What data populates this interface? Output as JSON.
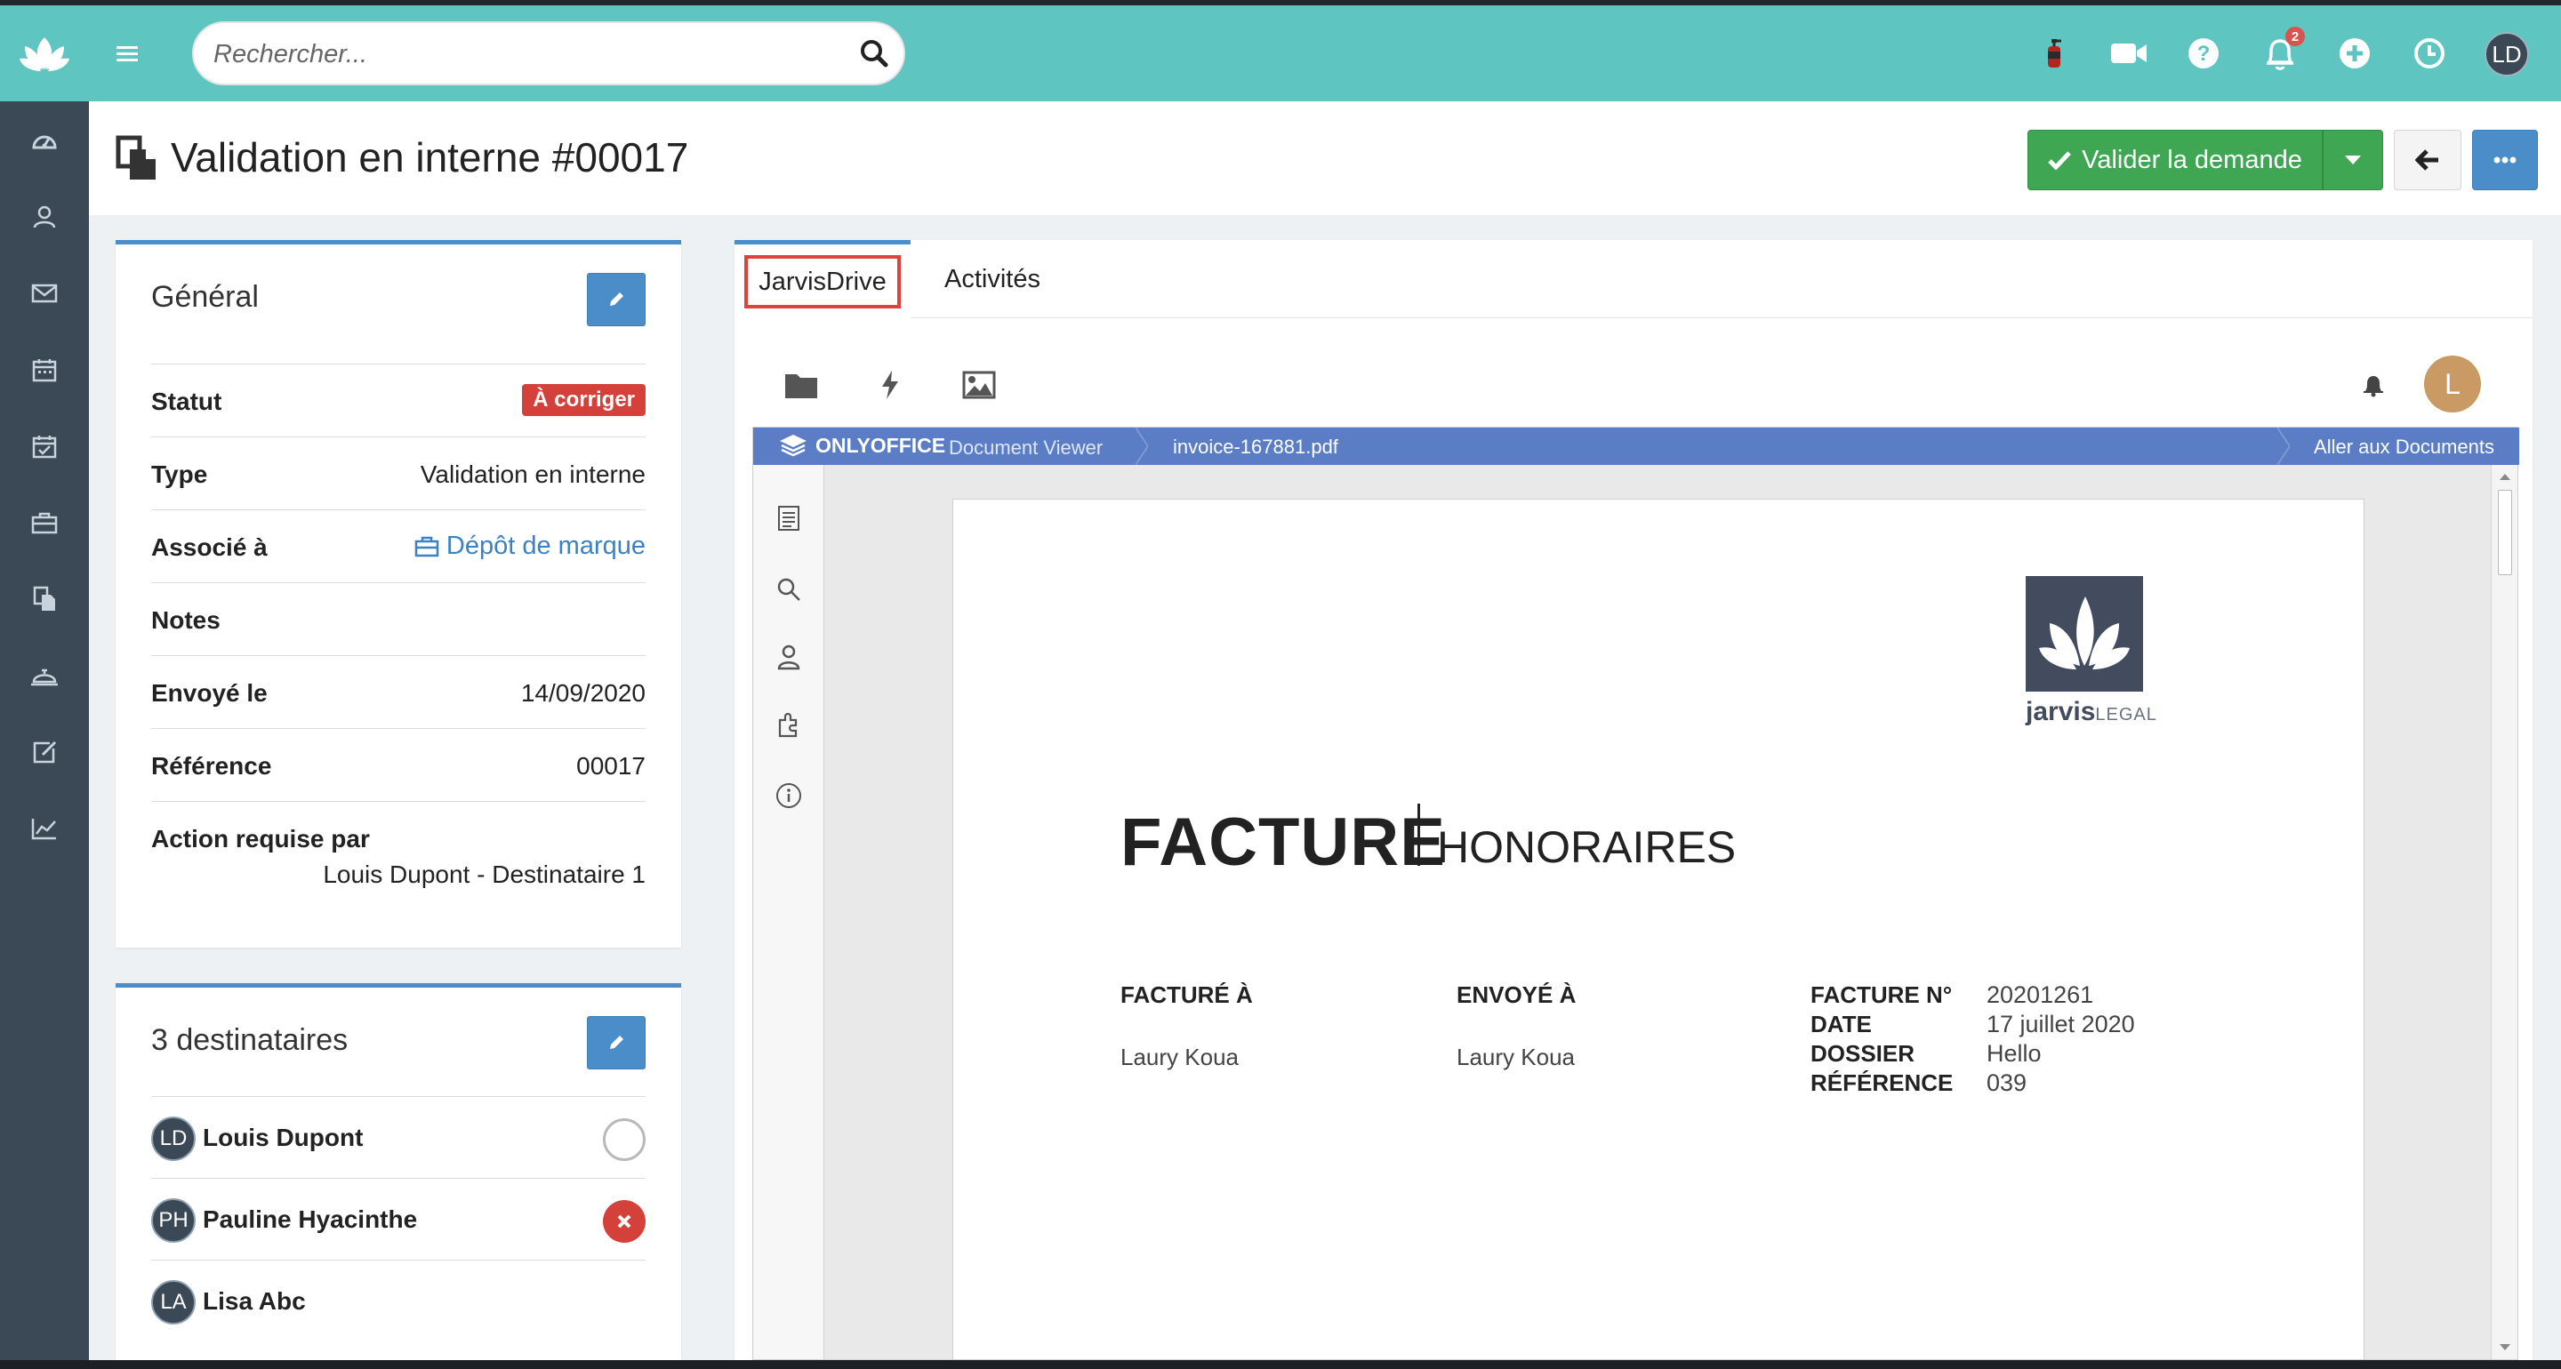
{
  "topbar": {
    "search_placeholder": "Rechercher...",
    "notifications_count": "2",
    "user_initials": "LD"
  },
  "sidebar": {
    "items": [
      {
        "icon": "dashboard-icon"
      },
      {
        "icon": "contacts-icon"
      },
      {
        "icon": "mail-icon"
      },
      {
        "icon": "calendar-icon"
      },
      {
        "icon": "tasks-calendar-icon"
      },
      {
        "icon": "briefcase-icon"
      },
      {
        "icon": "documents-icon"
      },
      {
        "icon": "bell-service-icon"
      },
      {
        "icon": "edit-icon"
      },
      {
        "icon": "chart-icon"
      }
    ]
  },
  "header": {
    "title": "Validation en interne #00017",
    "validate_label": "Valider la demande"
  },
  "general": {
    "title": "Général",
    "fields": [
      {
        "label": "Statut",
        "value": "À corriger"
      },
      {
        "label": "Type",
        "value": "Validation en interne"
      },
      {
        "label": "Associé à",
        "value": "Dépôt de marque"
      },
      {
        "label": "Notes",
        "value": ""
      },
      {
        "label": "Envoyé le",
        "value": "14/09/2020"
      },
      {
        "label": "Référence",
        "value": "00017"
      },
      {
        "label": "Action requise par",
        "value": "Louis Dupont - Destinataire 1"
      }
    ]
  },
  "recipients": {
    "title": "3 destinataires",
    "items": [
      {
        "initials": "LD",
        "name": "Louis Dupont",
        "status": "pending"
      },
      {
        "initials": "PH",
        "name": "Pauline Hyacinthe",
        "status": "rejected"
      },
      {
        "initials": "LA",
        "name": "Lisa Abc",
        "status": ""
      }
    ]
  },
  "tabs": [
    {
      "label": "JarvisDrive",
      "active": true
    },
    {
      "label": "Activités",
      "active": false
    }
  ],
  "drive": {
    "avatar_initial": "L",
    "viewer": {
      "brand": "ONLYOFFICE",
      "mode": "Document Viewer",
      "filename": "invoice-167881.pdf",
      "goto_label": "Aller aux Documents"
    },
    "document": {
      "logo_word": "jarvis",
      "logo_word_suffix": "LEGAL",
      "title": "FACTURE",
      "subtitle": "HONORAIRES",
      "billed_to_label": "FACTURÉ À",
      "billed_to_value": "Laury Koua",
      "sent_to_label": "ENVOYÉ À",
      "sent_to_value": "Laury Koua",
      "meta": [
        {
          "label": "FACTURE N°",
          "value": "20201261"
        },
        {
          "label": "DATE",
          "value": "17 juillet 2020"
        },
        {
          "label": "DOSSIER",
          "value": "Hello"
        },
        {
          "label": "RÉFÉRENCE",
          "value": "039"
        }
      ]
    }
  },
  "colors": {
    "topbar": "#5ec5c0",
    "sidebar": "#3b4956",
    "primary_blue": "#4a8dc8",
    "success_green": "#3fa654",
    "danger_red": "#d4403a",
    "onlyoffice_blue": "#5a7dc5"
  }
}
